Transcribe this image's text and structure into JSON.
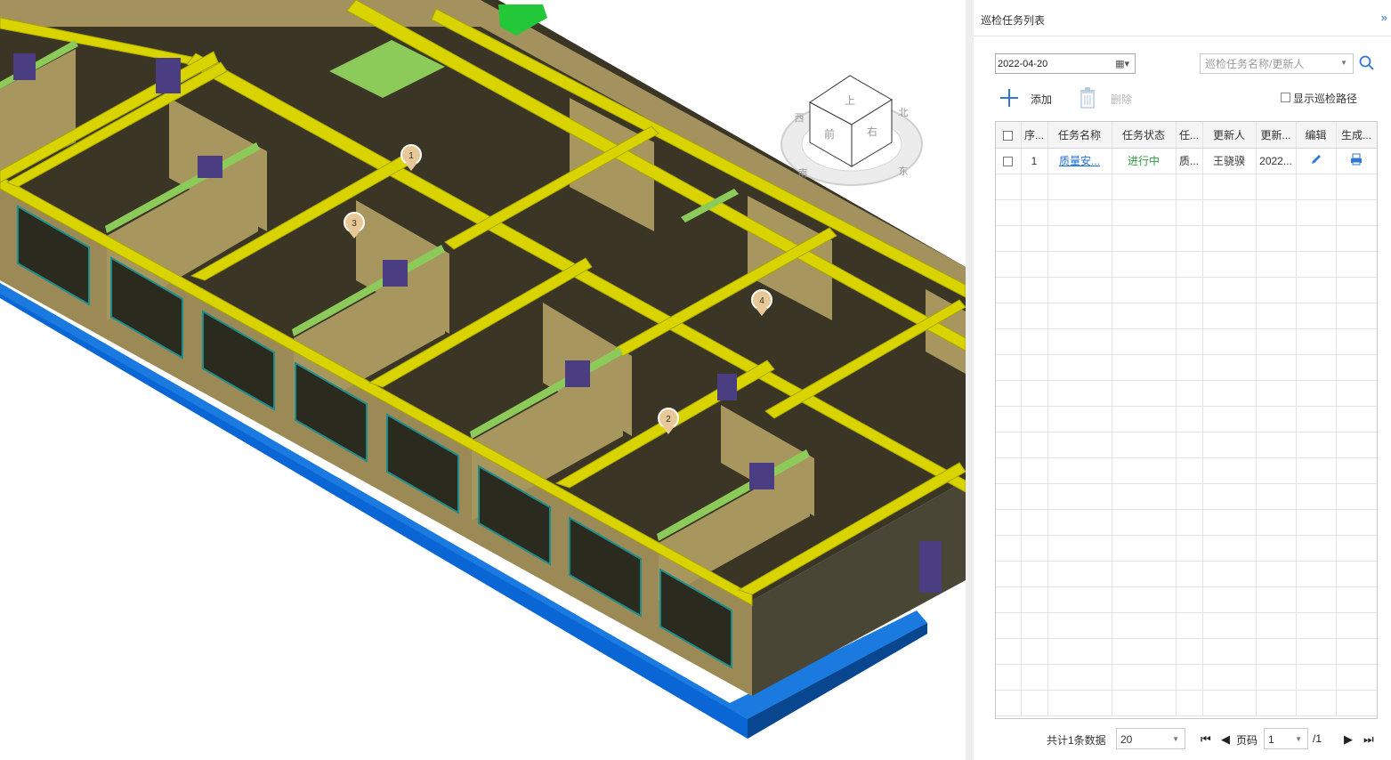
{
  "viewport": {
    "markers": [
      "1",
      "2",
      "3",
      "4"
    ],
    "nav_cube": {
      "faces": [
        "上",
        "前",
        "右"
      ],
      "directions": [
        "西",
        "北",
        "南",
        "东"
      ]
    }
  },
  "panel": {
    "title": "巡检任务列表",
    "collapse_icon": "»",
    "date_value": "2022-04-20",
    "search_placeholder": "巡检任务名称/更新人",
    "add_label": "添加",
    "delete_label": "删除",
    "show_route_label": "显示巡检路径",
    "columns": [
      "序...",
      "任务名称",
      "任务状态",
      "任...",
      "更新人",
      "更新...",
      "编辑",
      "生成..."
    ],
    "rows": [
      {
        "index": "1",
        "name": "质量安...",
        "status": "进行中",
        "type": "质...",
        "updater": "王骁骙",
        "updated": "2022...",
        "edit_icon": "pencil-icon",
        "print_icon": "printer-icon"
      }
    ],
    "footer": {
      "total_text": "共计1条数据",
      "page_size": "20",
      "page_label": "页码",
      "page_value": "1",
      "page_total": "/1"
    }
  },
  "colors": {
    "accent": "#2f78d6",
    "status_green": "#2e9b3e",
    "link": "#1e6fd9"
  }
}
